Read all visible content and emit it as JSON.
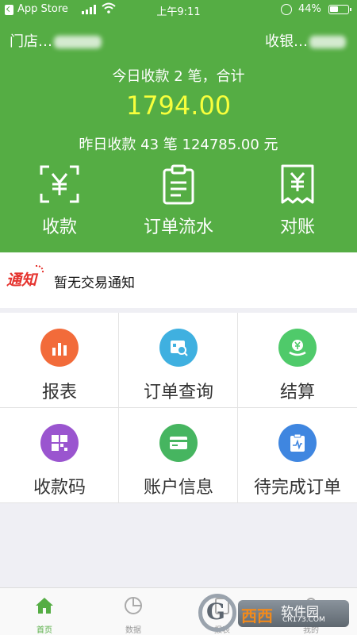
{
  "status_bar": {
    "back_app": "App Store",
    "time": "上午9:11",
    "battery": "44%"
  },
  "header": {
    "store_label": "门店…",
    "cashier_label": "收银…",
    "today_summary": "今日收款 2 笔，合计",
    "today_amount": "1794.00",
    "yesterday_summary": "昨日收款 43 笔 124785.00 元"
  },
  "actions": [
    {
      "label": "收款",
      "icon": "scan-yuan-icon"
    },
    {
      "label": "订单流水",
      "icon": "clipboard-icon"
    },
    {
      "label": "对账",
      "icon": "receipt-yuan-icon"
    }
  ],
  "notice": {
    "tag": "通知",
    "text": "暂无交易通知"
  },
  "menu": [
    {
      "label": "报表",
      "icon": "bar-chart-icon",
      "color": "#f26b3a"
    },
    {
      "label": "订单查询",
      "icon": "order-search-icon",
      "color": "#3fb0e0"
    },
    {
      "label": "结算",
      "icon": "settlement-icon",
      "color": "#4fca6a"
    },
    {
      "label": "收款码",
      "icon": "qr-grid-icon",
      "color": "#9a55cf"
    },
    {
      "label": "账户信息",
      "icon": "card-icon",
      "color": "#46b560"
    },
    {
      "label": "待完成订单",
      "icon": "pending-order-icon",
      "color": "#3f86e0"
    }
  ],
  "tabs": [
    {
      "label": "首页",
      "icon": "home-icon"
    },
    {
      "label": "数据",
      "icon": "pie-chart-icon"
    },
    {
      "label": "报表",
      "icon": "report-icon"
    },
    {
      "label": "我的",
      "icon": "profile-icon"
    }
  ],
  "watermark": {
    "name": "西西",
    "text": "软件园",
    "domain": "CR173.COM"
  },
  "colors": {
    "brand_green": "#55ad44",
    "amount_yellow": "#f7ff3c",
    "notice_red": "#e5322d"
  }
}
